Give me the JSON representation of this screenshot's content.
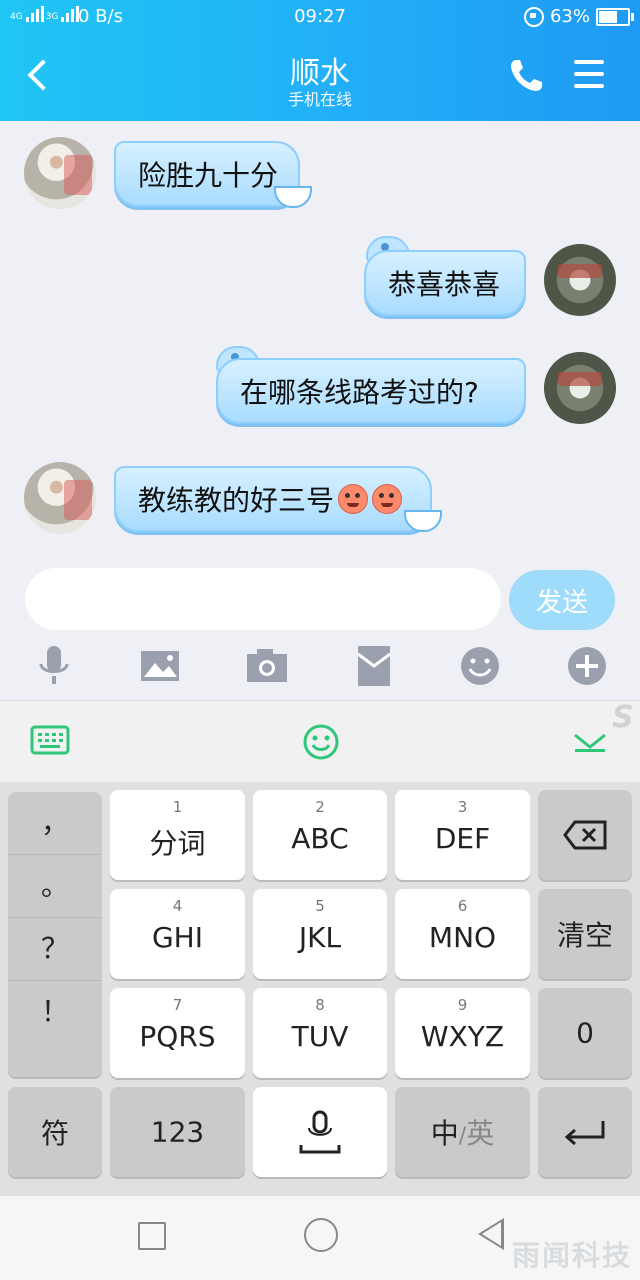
{
  "status_bar": {
    "net_a": "4G",
    "net_b": "3G",
    "speed": "0 B/s",
    "time": "09:27",
    "battery": "63%"
  },
  "header": {
    "title": "顺水",
    "subtitle": "手机在线"
  },
  "messages": [
    {
      "side": "left",
      "text": "险胜九十分"
    },
    {
      "side": "right",
      "text": "恭喜恭喜"
    },
    {
      "side": "right",
      "text": "在哪条线路考过的?"
    },
    {
      "side": "left",
      "text": "教练教的好三号"
    }
  ],
  "input": {
    "placeholder": "",
    "send_label": "发送"
  },
  "toolbar": {
    "icons": [
      "microphone-icon",
      "image-icon",
      "camera-icon",
      "red-packet-icon",
      "emoji-icon",
      "plus-icon"
    ]
  },
  "keyboard": {
    "punctuation": [
      "，",
      "。",
      "？",
      "！"
    ],
    "keys": [
      {
        "num": "1",
        "label": "分词"
      },
      {
        "num": "2",
        "label": "ABC"
      },
      {
        "num": "3",
        "label": "DEF"
      },
      {
        "num": "4",
        "label": "GHI"
      },
      {
        "num": "5",
        "label": "JKL"
      },
      {
        "num": "6",
        "label": "MNO"
      },
      {
        "num": "7",
        "label": "PQRS"
      },
      {
        "num": "8",
        "label": "TUV"
      },
      {
        "num": "9",
        "label": "WXYZ"
      }
    ],
    "clear": "清空",
    "zero": "0",
    "symbol": "符",
    "numbers": "123",
    "lang_zh": "中",
    "lang_sep": "/",
    "lang_en": "英"
  },
  "watermark": "雨闻科技",
  "corner_mark": "S",
  "colors": {
    "header": "#22aef7",
    "accent_green": "#2ec77a",
    "send": "#9fdcfb"
  }
}
